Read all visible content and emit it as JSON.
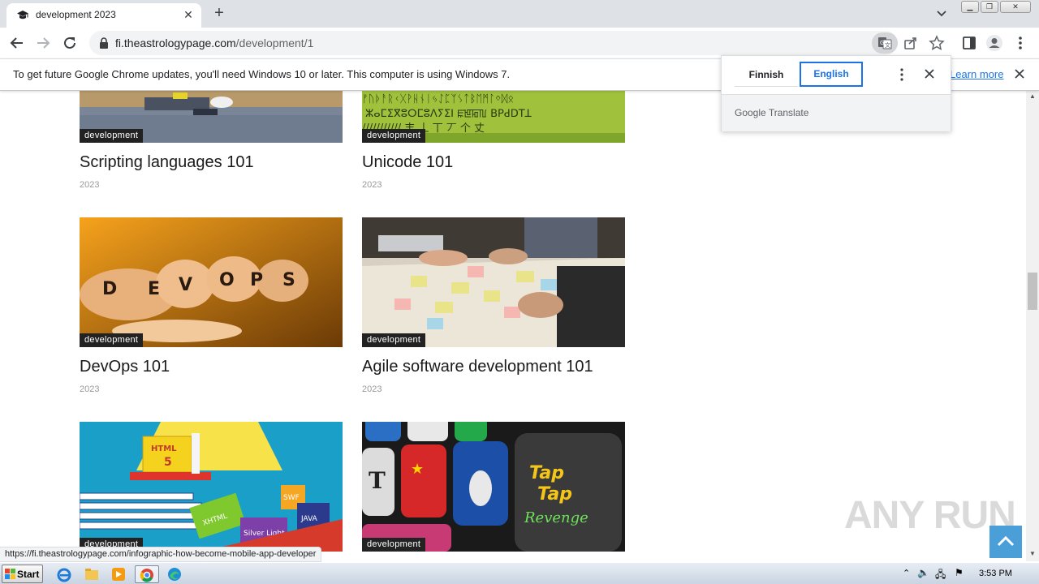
{
  "browser": {
    "tab_title": "development 2023",
    "tab_close": "✕",
    "new_tab": "+",
    "url_domain": "fi.theastrologypage.com",
    "url_path": "/development/1",
    "status_url": "https://fi.theastrologypage.com/infographic-how-become-mobile-app-developer"
  },
  "infobar": {
    "message": "To get future Google Chrome updates, you'll need Windows 10 or later. This computer is using Windows 7.",
    "learn_more": "Learn more"
  },
  "translate": {
    "source_lang": "Finnish",
    "target_lang": "English",
    "brand": "Google Translate"
  },
  "articles": [
    {
      "title": "Scripting languages 101",
      "year": "2023",
      "category": "development",
      "image": "laptop-desk"
    },
    {
      "title": "Unicode 101",
      "year": "2023",
      "category": "development",
      "image": "unicode-glyphs"
    },
    {
      "title": "DevOps 101",
      "year": "2023",
      "category": "development",
      "image": "devops-fingers"
    },
    {
      "title": "Agile software development 101",
      "year": "2023",
      "category": "development",
      "image": "agile-sticky-notes"
    },
    {
      "title": "",
      "year": "",
      "category": "development",
      "image": "html5-illustration"
    },
    {
      "title": "",
      "year": "",
      "category": "development",
      "image": "app-icons"
    }
  ],
  "watermark": "ANY RUN",
  "taskbar": {
    "start_label": "Start",
    "clock": "3:53 PM"
  },
  "colors": {
    "chrome_tabstrip": "#dee1e6",
    "accent_blue": "#1a73e8",
    "badge_bg": "#222222",
    "scroll_top_button": "#4a9fd8"
  }
}
